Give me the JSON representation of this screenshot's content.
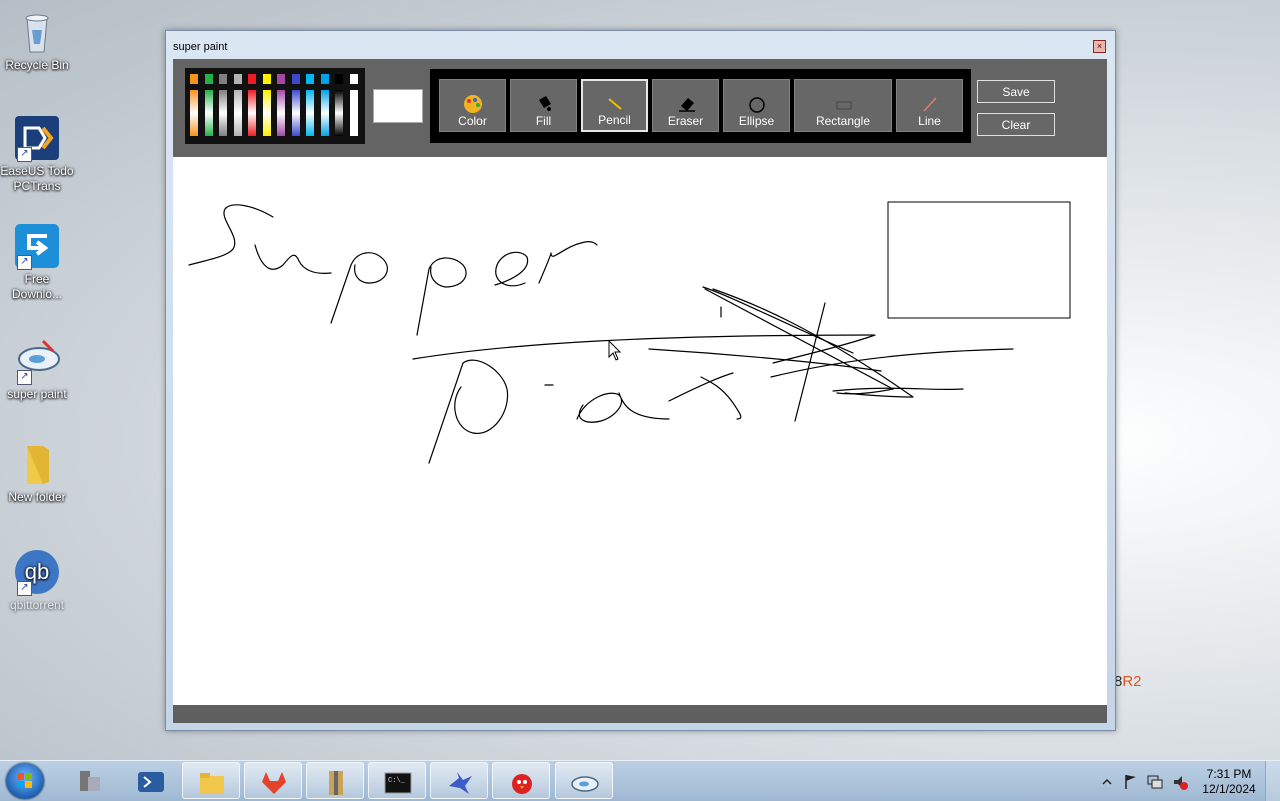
{
  "desktop": {
    "icons": [
      {
        "label": "Recycle Bin",
        "icon": "recycle-bin-icon"
      },
      {
        "label": "EaseUS Todo\nPCTrans",
        "icon": "easeus-todo-pctrans-icon"
      },
      {
        "label": "Free\nDownlo...",
        "icon": "free-download-manager-icon"
      },
      {
        "label": "super paint",
        "icon": "super-paint-icon"
      },
      {
        "label": "New folder",
        "icon": "folder-icon"
      },
      {
        "label": "qbittorrent",
        "icon": "qbittorrent-icon"
      }
    ],
    "os_mark": {
      "number": "8",
      "suffix": "R2"
    }
  },
  "window": {
    "title": "super paint",
    "close_label": "×"
  },
  "toolbar": {
    "current_color": "#ffffff",
    "palette_top": [
      "#f7941d",
      "#22b14c",
      "#7f7f7f",
      "#b3b3b3",
      "#ed1c24",
      "#ffef00",
      "#a349a4",
      "#3f48cc",
      "#00b7ef",
      "#00a2e8",
      "#000000",
      "#ffffff"
    ],
    "tools": [
      {
        "label": "Color",
        "icon": "palette-icon",
        "active": false
      },
      {
        "label": "Fill",
        "icon": "paint-bucket-icon",
        "active": false
      },
      {
        "label": "Pencil",
        "icon": "pencil-icon",
        "active": true
      },
      {
        "label": "Eraser",
        "icon": "eraser-icon",
        "active": false
      },
      {
        "label": "Ellipse",
        "icon": "ellipse-icon",
        "active": false
      },
      {
        "label": "Rectangle",
        "icon": "rectangle-icon",
        "active": false
      },
      {
        "label": "Line",
        "icon": "line-icon",
        "active": false
      }
    ],
    "save_label": "Save",
    "clear_label": "Clear"
  },
  "taskbar": {
    "apps": [
      {
        "name": "server-manager-icon",
        "running": false
      },
      {
        "name": "powershell-icon",
        "running": false
      },
      {
        "name": "file-explorer-icon",
        "running": true
      },
      {
        "name": "gitlab-icon",
        "running": true
      },
      {
        "name": "archive-icon",
        "running": true
      },
      {
        "name": "command-prompt-icon",
        "running": true
      },
      {
        "name": "bird-app-icon",
        "running": true
      },
      {
        "name": "angry-birds-icon",
        "running": true
      },
      {
        "name": "super-paint-icon",
        "running": true
      }
    ],
    "clock": {
      "time": "7:31 PM",
      "date": "12/1/2024"
    }
  }
}
